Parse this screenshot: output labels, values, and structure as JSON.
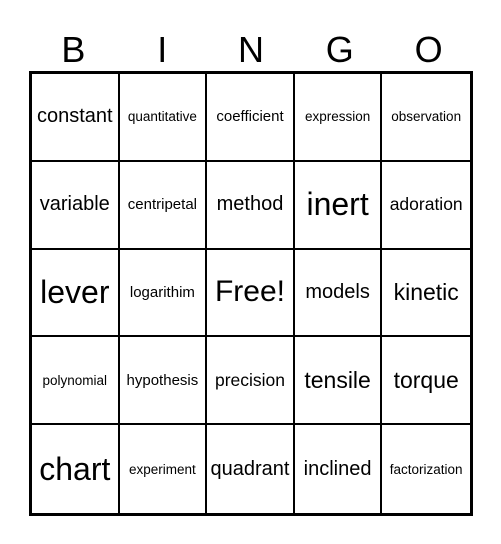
{
  "header": {
    "letters": [
      "B",
      "I",
      "N",
      "G",
      "O"
    ]
  },
  "card": {
    "cells": [
      "constant",
      "quantitative",
      "coefficient",
      "expression",
      "observation",
      "variable",
      "centripetal",
      "method",
      "inert",
      "adoration",
      "lever",
      "logarithim",
      "Free!",
      "models",
      "kinetic",
      "polynomial",
      "hypothesis",
      "precision",
      "tensile",
      "torque",
      "chart",
      "experiment",
      "quadrant",
      "inclined",
      "factorization"
    ],
    "free_space_label": "Free!"
  }
}
